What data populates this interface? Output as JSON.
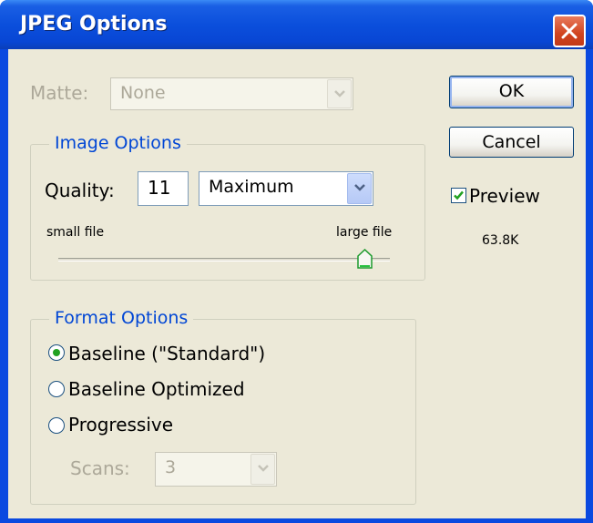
{
  "window": {
    "title": "JPEG Options"
  },
  "matte": {
    "label": "Matte:",
    "value": "None"
  },
  "image_options": {
    "legend": "Image Options",
    "quality_label": "Quality:",
    "quality_value": "11",
    "quality_preset": "Maximum",
    "small_label": "small file",
    "large_label": "large file",
    "slider_fraction": 1.0
  },
  "format_options": {
    "legend": "Format Options",
    "options": [
      "Baseline (\"Standard\")",
      "Baseline Optimized",
      "Progressive"
    ],
    "selected_index": 0,
    "scans_label": "Scans:",
    "scans_value": "3"
  },
  "buttons": {
    "ok": "OK",
    "cancel": "Cancel"
  },
  "preview": {
    "label": "Preview",
    "checked": true,
    "file_size": "63.8K"
  },
  "colors": {
    "title_bar": "#0a49e0",
    "accent": "#0046d5",
    "dialog_bg": "#ece9d8",
    "close": "#d1441f",
    "check": "#21a121"
  }
}
